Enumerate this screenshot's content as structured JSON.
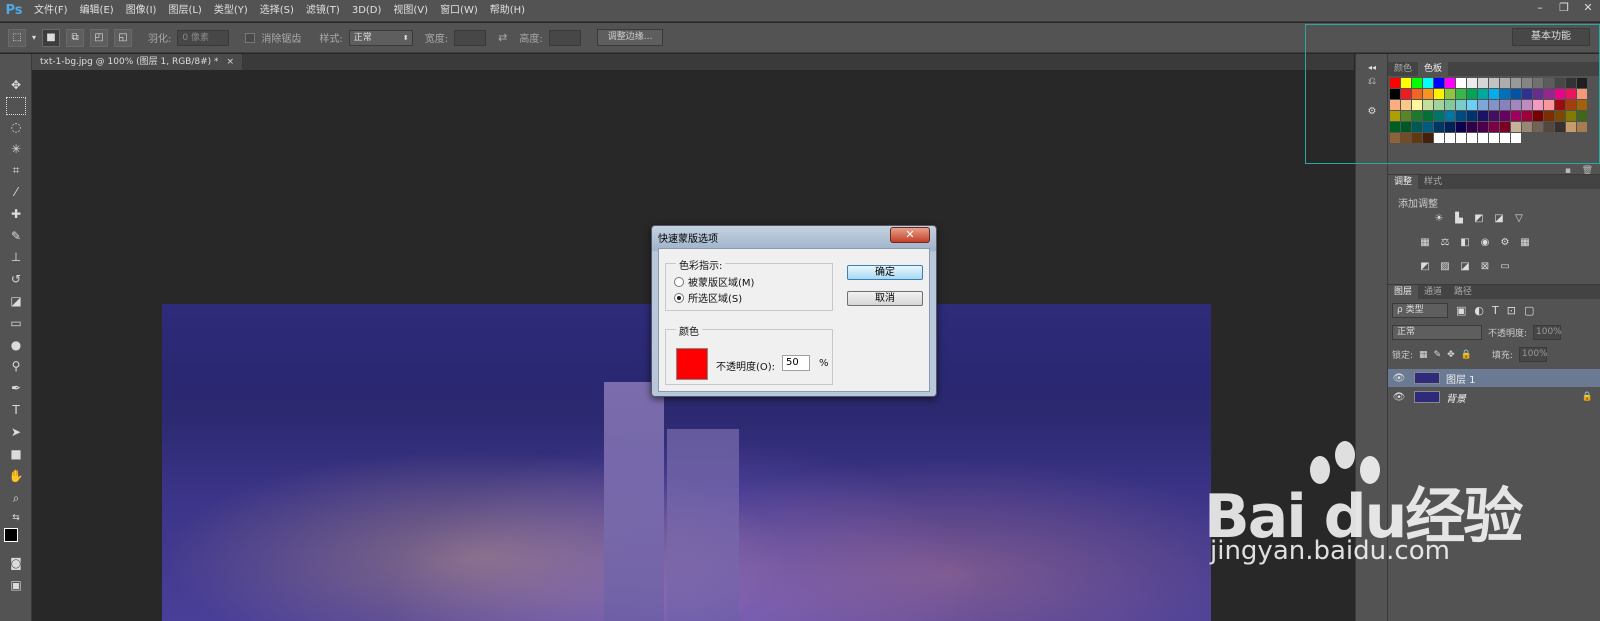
{
  "app": {
    "logo": "Ps"
  },
  "menu": [
    "文件(F)",
    "编辑(E)",
    "图像(I)",
    "图层(L)",
    "类型(Y)",
    "选择(S)",
    "滤镜(T)",
    "3D(D)",
    "视图(V)",
    "窗口(W)",
    "帮助(H)"
  ],
  "window_controls": [
    "–",
    "❐",
    "✕"
  ],
  "options": {
    "feather_label": "羽化:",
    "feather_value": "0 像素",
    "antialias_label": "消除锯齿",
    "style_label": "样式:",
    "style_value": "正常",
    "width_label": "宽度:",
    "height_label": "高度:",
    "refine_button": "调整边缘...",
    "workspace": "基本功能"
  },
  "document_tab": {
    "title": "txt-1-bg.jpg @ 100% (图层 1, RGB/8#) *",
    "close": "×"
  },
  "panels": {
    "color_tab": "颜色",
    "swatches_tab": "色板",
    "adjust_tab": "调整",
    "styles_tab": "样式",
    "adjust_title": "添加调整",
    "layers_tab": "图层",
    "channels_tab": "通道",
    "paths_tab": "路径",
    "filter_kind": "ρ 类型",
    "blend_mode": "正常",
    "opacity_label": "不透明度:",
    "opacity_value": "100%",
    "lock_label": "锁定:",
    "fill_label": "填充:",
    "fill_value": "100%",
    "layers": [
      {
        "name": "图层 1",
        "selected": true
      },
      {
        "name": "背景",
        "selected": false
      }
    ]
  },
  "swatch_colors": [
    "#ff0000",
    "#ffff00",
    "#00ff00",
    "#00ffff",
    "#0000ff",
    "#ff00ff",
    "#ffffff",
    "#ebebeb",
    "#d6d6d6",
    "#c2c2c2",
    "#adadad",
    "#999999",
    "#858585",
    "#707070",
    "#5c5c5c",
    "#474747",
    "#333333",
    "#1f1f1f",
    "#000000",
    "#ed1c24",
    "#f26522",
    "#f7941d",
    "#fff200",
    "#8dc63f",
    "#39b54a",
    "#00a651",
    "#00a99d",
    "#00aeef",
    "#0072bc",
    "#0054a6",
    "#2e3192",
    "#662d91",
    "#92278f",
    "#ec008c",
    "#ed145b",
    "#f7977a",
    "#f9ad81",
    "#fdc68a",
    "#fff79a",
    "#c4df9b",
    "#a3d39c",
    "#82ca9d",
    "#7accc8",
    "#6dcff6",
    "#7da7d9",
    "#8393ca",
    "#8781bd",
    "#a187be",
    "#bd8cbf",
    "#f49ac2",
    "#f6989d",
    "#9e0b0f",
    "#a0410d",
    "#a3620a",
    "#aba000",
    "#598527",
    "#1a7b30",
    "#007236",
    "#00746b",
    "#0076a3",
    "#004a80",
    "#003471",
    "#1b1464",
    "#440e62",
    "#630460",
    "#9e005d",
    "#9e0039",
    "#790000",
    "#7b2e00",
    "#7d4900",
    "#827b00",
    "#406618",
    "#005e20",
    "#005826",
    "#005952",
    "#005b7f",
    "#003663",
    "#002157",
    "#0d004c",
    "#32004b",
    "#4b0049",
    "#7b0046",
    "#7a0026",
    "#c7b299",
    "#998675",
    "#736357",
    "#534741",
    "#37302d",
    "#c69c6d",
    "#a67c52",
    "#8c6239",
    "#754c24",
    "#603913",
    "#42210b",
    "#ffffff",
    "#ffffff",
    "#ffffff",
    "#ffffff",
    "#ffffff",
    "#ffffff",
    "#ffffff",
    "#ffffff"
  ],
  "dialog": {
    "title": "快速蒙版选项",
    "close": "✕",
    "color_indicates_legend": "色彩指示:",
    "option_masked": "被蒙版区域(M)",
    "option_selected": "所选区域(S)",
    "selected_option": "所选区域(S)",
    "color_legend": "颜色",
    "opacity_label": "不透明度(O):",
    "opacity_value": "50",
    "percent": "%",
    "ok": "确定",
    "cancel": "取消",
    "mask_color": "#ff0000"
  },
  "watermark": {
    "brand": "Bai du经验",
    "url": "jingyan.baidu.com"
  }
}
